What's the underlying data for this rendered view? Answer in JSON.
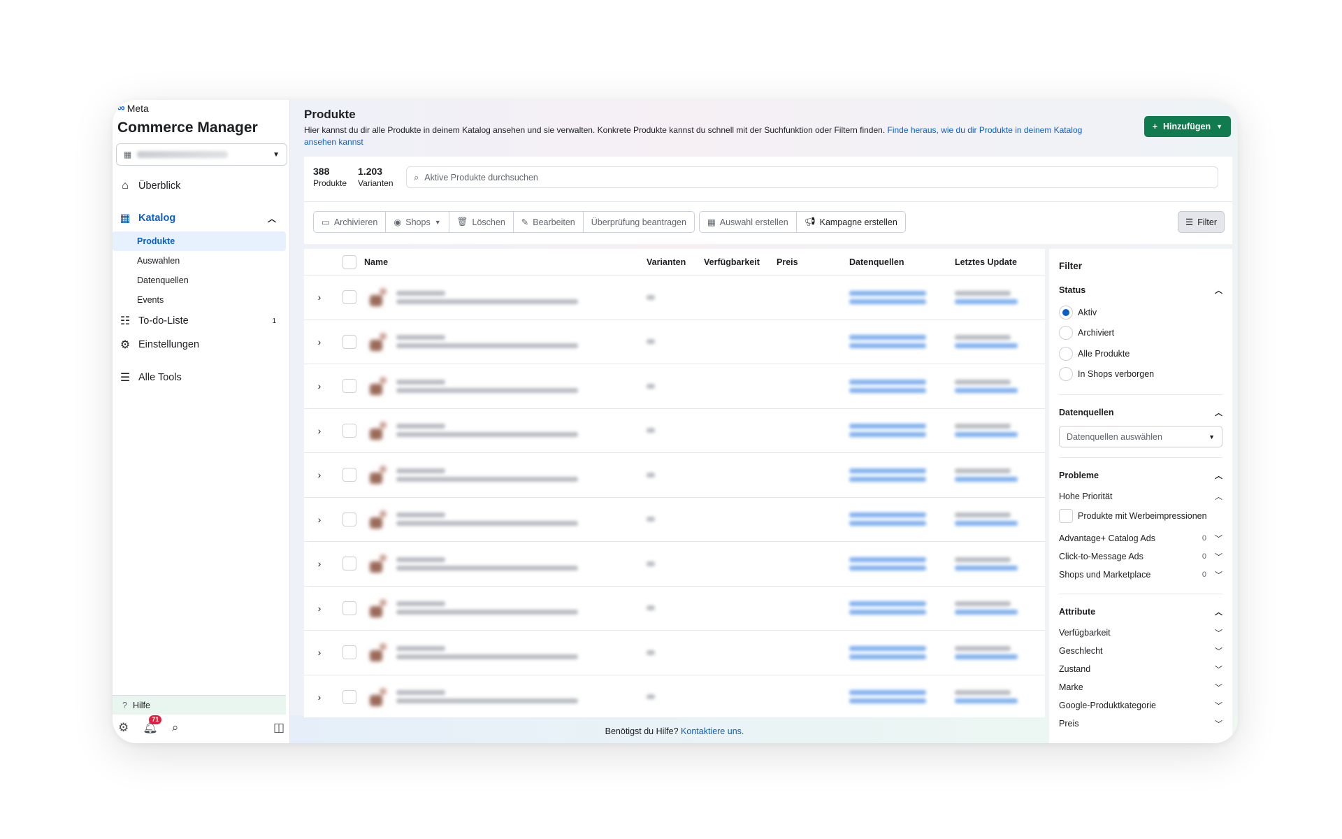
{
  "sidebar": {
    "brand": "Meta",
    "app_title": "Commerce Manager",
    "account_name": "",
    "nav": {
      "overview": "Überblick",
      "catalog": "Katalog",
      "catalog_sub": [
        "Produkte",
        "Auswahlen",
        "Datenquellen",
        "Events"
      ],
      "todo": "To-do-Liste",
      "todo_count": "1",
      "settings": "Einstellungen",
      "all_tools": "Alle Tools"
    },
    "help": "Hilfe",
    "notification_count": "71"
  },
  "header": {
    "title": "Produkte",
    "description": "Hier kannst du dir alle Produkte in deinem Katalog ansehen und sie verwalten. Konkrete Produkte kannst du schnell mit der Suchfunktion oder Filtern finden. ",
    "link_text": "Finde heraus, wie du dir Produkte in deinem Katalog ansehen kannst",
    "add_button": "Hinzufügen"
  },
  "stats": {
    "products_count": "388",
    "products_label": "Produkte",
    "variants_count": "1.203",
    "variants_label": "Varianten"
  },
  "search": {
    "placeholder": "Aktive Produkte durchsuchen"
  },
  "toolbar": {
    "archive": "Archivieren",
    "shops": "Shops",
    "delete": "Löschen",
    "edit": "Bearbeiten",
    "request_review": "Überprüfung beantragen",
    "create_selection": "Auswahl erstellen",
    "create_campaign": "Kampagne erstellen",
    "filter": "Filter"
  },
  "table": {
    "columns": [
      "Name",
      "Varianten",
      "Verfügbarkeit",
      "Preis",
      "Datenquellen",
      "Letztes Update"
    ],
    "row_count": 10
  },
  "filter_panel": {
    "title": "Filter",
    "status": {
      "title": "Status",
      "options": [
        "Aktiv",
        "Archiviert",
        "Alle Produkte",
        "In Shops verborgen"
      ],
      "selected": "Aktiv"
    },
    "datasources": {
      "title": "Datenquellen",
      "placeholder": "Datenquellen auswählen"
    },
    "problems": {
      "title": "Probleme",
      "high_priority": "Hohe Priorität",
      "ad_impressions": "Produkte mit Werbeimpressionen",
      "items": [
        {
          "label": "Advantage+ Catalog Ads",
          "count": "0"
        },
        {
          "label": "Click-to-Message Ads",
          "count": "0"
        },
        {
          "label": "Shops und Marketplace",
          "count": "0"
        }
      ]
    },
    "attributes": {
      "title": "Attribute",
      "items": [
        "Verfügbarkeit",
        "Geschlecht",
        "Zustand",
        "Marke",
        "Google-Produktkategorie",
        "Preis"
      ]
    }
  },
  "footer": {
    "help_text": "Benötigst du Hilfe? ",
    "contact_link": "Kontaktiere uns."
  },
  "colors": {
    "accent": "#0a5fc7",
    "primary_button": "#0f7b4e",
    "notification": "#e41e3f"
  }
}
